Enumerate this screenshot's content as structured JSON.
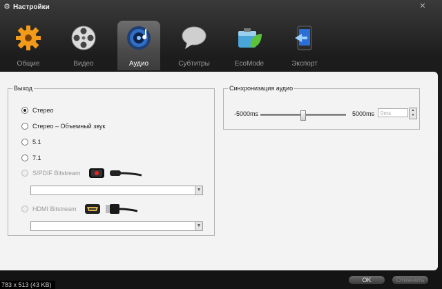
{
  "window": {
    "title": "Настройки"
  },
  "tabs": [
    {
      "label": "Общие",
      "icon": "gear-icon",
      "active": false
    },
    {
      "label": "Видео",
      "icon": "film-reel-icon",
      "active": false
    },
    {
      "label": "Аудио",
      "icon": "speaker-icon",
      "active": true
    },
    {
      "label": "Субтитры",
      "icon": "speech-bubble-icon",
      "active": false
    },
    {
      "label": "EcoMode",
      "icon": "battery-leaf-icon",
      "active": false
    },
    {
      "label": "Экспорт",
      "icon": "phone-export-icon",
      "active": false
    }
  ],
  "output": {
    "legend": "Выход",
    "options": [
      {
        "label": "Стерео",
        "checked": true,
        "enabled": true
      },
      {
        "label": "Стерео – Объемный звук",
        "checked": false,
        "enabled": true
      },
      {
        "label": "5.1",
        "checked": false,
        "enabled": true
      },
      {
        "label": "7.1",
        "checked": false,
        "enabled": true
      },
      {
        "label": "S/PDIF Bitstream",
        "checked": false,
        "enabled": false
      },
      {
        "label": "HDMI Bitstream",
        "checked": false,
        "enabled": false
      }
    ],
    "spdif_combo_value": "",
    "hdmi_combo_value": ""
  },
  "sync": {
    "legend": "Синхронизация аудио",
    "min_label": "-5000ms",
    "max_label": "5000ms",
    "value": "0ms",
    "slider_fraction": 0.5
  },
  "buttons": {
    "ok": "OK",
    "cancel": "Отменить"
  },
  "status": "783 x 513 (43 KB)",
  "colors": {
    "panel": "#f3f3f3",
    "chrome": "#1c1c1c",
    "active_tab": "#5a5a5a"
  }
}
